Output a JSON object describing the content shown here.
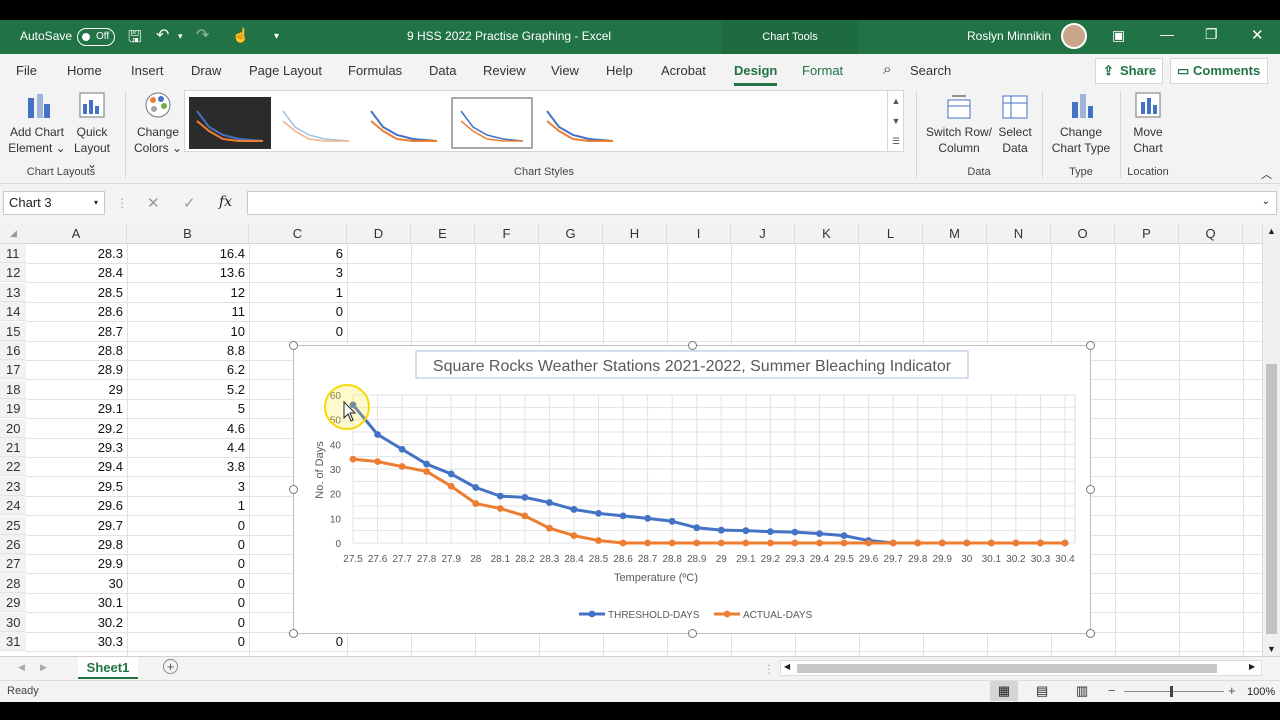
{
  "titlebar": {
    "autosave_label": "AutoSave",
    "autosave_state": "Off",
    "document_title": "9 HSS 2022 Practise Graphing  -  Excel",
    "context_label": "Chart Tools",
    "user_name": "Roslyn Minnikin"
  },
  "tabs": [
    "File",
    "Home",
    "Insert",
    "Draw",
    "Page Layout",
    "Formulas",
    "Data",
    "Review",
    "View",
    "Help",
    "Acrobat",
    "Design",
    "Format"
  ],
  "search_label": "Search",
  "share_label": "Share",
  "comments_label": "Comments",
  "ribbon": {
    "add_chart_element": [
      "Add Chart",
      "Element ⌄"
    ],
    "quick_layout": [
      "Quick",
      "Layout ⌄"
    ],
    "chart_layouts": "Chart Layouts",
    "change_colors": [
      "Change",
      "Colors ⌄"
    ],
    "chart_styles": "Chart Styles",
    "switch_row_column": [
      "Switch Row/",
      "Column"
    ],
    "select_data": [
      "Select",
      "Data"
    ],
    "data_group": "Data",
    "change_chart_type": [
      "Change",
      "Chart Type"
    ],
    "type_group": "Type",
    "move_chart": [
      "Move",
      "Chart"
    ],
    "location_group": "Location"
  },
  "namebox": "Chart 3",
  "fx": "fx",
  "columns": [
    "A",
    "B",
    "C",
    "D",
    "E",
    "F",
    "G",
    "H",
    "I",
    "J",
    "K",
    "L",
    "M",
    "N",
    "O",
    "P",
    "Q"
  ],
  "rows": [
    {
      "n": "11",
      "a": "28.3",
      "b": "16.4",
      "c": "6"
    },
    {
      "n": "12",
      "a": "28.4",
      "b": "13.6",
      "c": "3"
    },
    {
      "n": "13",
      "a": "28.5",
      "b": "12",
      "c": "1"
    },
    {
      "n": "14",
      "a": "28.6",
      "b": "11",
      "c": "0"
    },
    {
      "n": "15",
      "a": "28.7",
      "b": "10",
      "c": "0"
    },
    {
      "n": "16",
      "a": "28.8",
      "b": "8.8",
      "c": ""
    },
    {
      "n": "17",
      "a": "28.9",
      "b": "6.2",
      "c": ""
    },
    {
      "n": "18",
      "a": "29",
      "b": "5.2",
      "c": ""
    },
    {
      "n": "19",
      "a": "29.1",
      "b": "5",
      "c": ""
    },
    {
      "n": "20",
      "a": "29.2",
      "b": "4.6",
      "c": ""
    },
    {
      "n": "21",
      "a": "29.3",
      "b": "4.4",
      "c": ""
    },
    {
      "n": "22",
      "a": "29.4",
      "b": "3.8",
      "c": ""
    },
    {
      "n": "23",
      "a": "29.5",
      "b": "3",
      "c": ""
    },
    {
      "n": "24",
      "a": "29.6",
      "b": "1",
      "c": ""
    },
    {
      "n": "25",
      "a": "29.7",
      "b": "0",
      "c": ""
    },
    {
      "n": "26",
      "a": "29.8",
      "b": "0",
      "c": ""
    },
    {
      "n": "27",
      "a": "29.9",
      "b": "0",
      "c": ""
    },
    {
      "n": "28",
      "a": "30",
      "b": "0",
      "c": ""
    },
    {
      "n": "29",
      "a": "30.1",
      "b": "0",
      "c": ""
    },
    {
      "n": "30",
      "a": "30.2",
      "b": "0",
      "c": ""
    },
    {
      "n": "31",
      "a": "30.3",
      "b": "0",
      "c": "0"
    }
  ],
  "sheet_tab": "Sheet1",
  "status": {
    "ready": "Ready",
    "zoom": "100%"
  },
  "chart_data": {
    "type": "line",
    "title": "Square Rocks Weather Stations 2021-2022, Summer Bleaching Indicator",
    "xlabel": "Temperature (ºC)",
    "ylabel": "No. of Days",
    "ylim": [
      0,
      60
    ],
    "yticks": [
      "0",
      "10",
      "20",
      "30",
      "40",
      "50",
      "60"
    ],
    "grid": true,
    "legend": "bottom",
    "categories": [
      "27.5",
      "27.6",
      "27.7",
      "27.8",
      "27.9",
      "28",
      "28.1",
      "28.2",
      "28.3",
      "28.4",
      "28.5",
      "28.6",
      "28.7",
      "28.8",
      "28.9",
      "29",
      "29.1",
      "29.2",
      "29.3",
      "29.4",
      "29.5",
      "29.6",
      "29.7",
      "29.8",
      "29.9",
      "30",
      "30.1",
      "30.2",
      "30.3",
      "30.4"
    ],
    "series": [
      {
        "name": "THRESHOLD-DAYS",
        "color": "#4472C4",
        "values": [
          56,
          44,
          38,
          32,
          28,
          22.5,
          19,
          18.5,
          16.4,
          13.6,
          12,
          11,
          10,
          8.8,
          6.2,
          5.2,
          5,
          4.6,
          4.4,
          3.8,
          3,
          1,
          0,
          0,
          0,
          0,
          0,
          0,
          0,
          0
        ]
      },
      {
        "name": "ACTUAL-DAYS",
        "color": "#ED7D31",
        "values": [
          34,
          33,
          31,
          29,
          23,
          16,
          14,
          11,
          6,
          3,
          1,
          0,
          0,
          0,
          0,
          0,
          0,
          0,
          0,
          0,
          0,
          0,
          0,
          0,
          0,
          0,
          0,
          0,
          0,
          0
        ]
      }
    ]
  },
  "colors": {
    "brand": "#217346",
    "threshold": "#4472C4",
    "actual": "#ED7D31"
  }
}
